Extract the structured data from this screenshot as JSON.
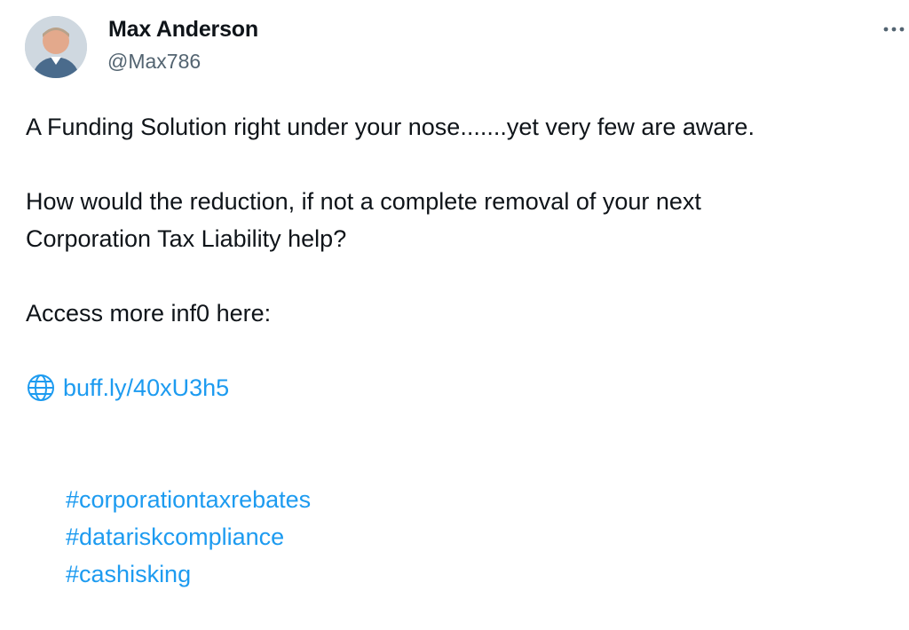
{
  "user": {
    "display_name": "Max Anderson",
    "handle": "@Max786"
  },
  "tweet": {
    "line1": "A Funding Solution right under your nose.......yet very few are aware.",
    "line2": "How would the reduction, if not a complete removal of your next\nCorporation Tax Liability help?",
    "line3": "Access more inf0 here:",
    "link_text": "buff.ly/40xU3h5",
    "hashtags": [
      "#corporationtaxrebates",
      "#datariskcompliance",
      "#cashisking"
    ]
  },
  "icons": {
    "more": "more-horizontal-icon",
    "link": "globe-icon"
  },
  "colors": {
    "text": "#0f1419",
    "secondary": "#536471",
    "link": "#1d9bf0"
  }
}
